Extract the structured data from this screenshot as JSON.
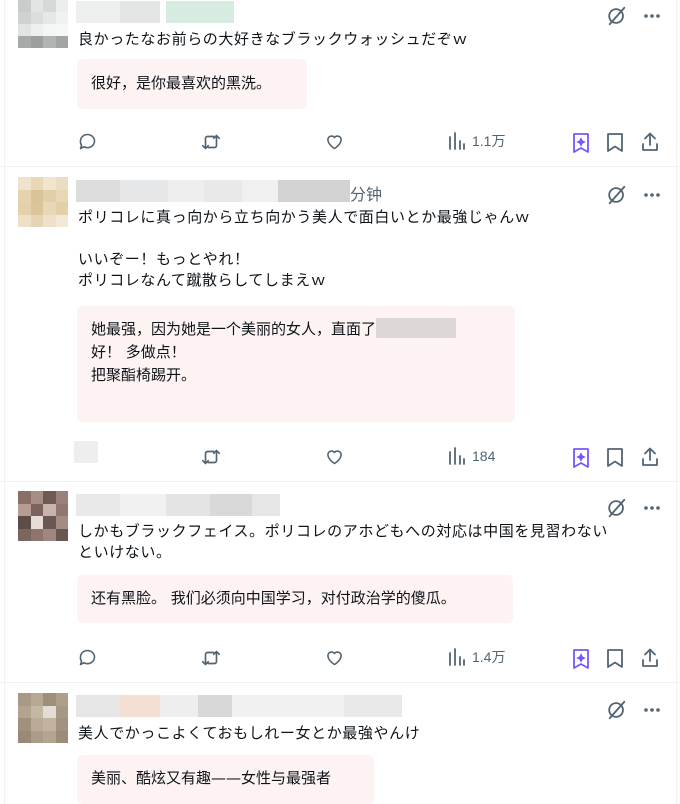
{
  "colors": {
    "accent": "#7856ff",
    "icon": "#536471",
    "translation_bg": "#fdf3f3",
    "divider": "#eff3f4"
  },
  "posts": [
    {
      "time_text": "",
      "text": "良かったなお前らの大好きなブラックウォッシュだぞｗ",
      "translation": "很好，是你最喜欢的黑洗。",
      "views": "1.1万"
    },
    {
      "time_text": "分钟",
      "text": "ポリコレに真っ向から立ち向かう美人で面白いとか最強じゃんｗ\n\nいいぞー！もっとやれ！\nポリコレなんて蹴散らしてしまえｗ",
      "translation_line1": "她最强，因为她是一个美丽的女人，直面了",
      "translation_rest": "好！ 多做点！\n把聚酯椅踢开。",
      "views": "184"
    },
    {
      "time_text": "",
      "text": "しかもブラックフェイス。ポリコレのアホどもへの対応は中国を見習わない\nといけない。",
      "translation": "还有黑脸。 我们必须向中国学习，对付政治学的傻瓜。",
      "views": "1.4万"
    },
    {
      "time_text": "",
      "text": "美人でかっこよくておもしれー女とか最強やんけ",
      "translation": "美丽、酷炫又有趣——女性与最强者"
    }
  ]
}
